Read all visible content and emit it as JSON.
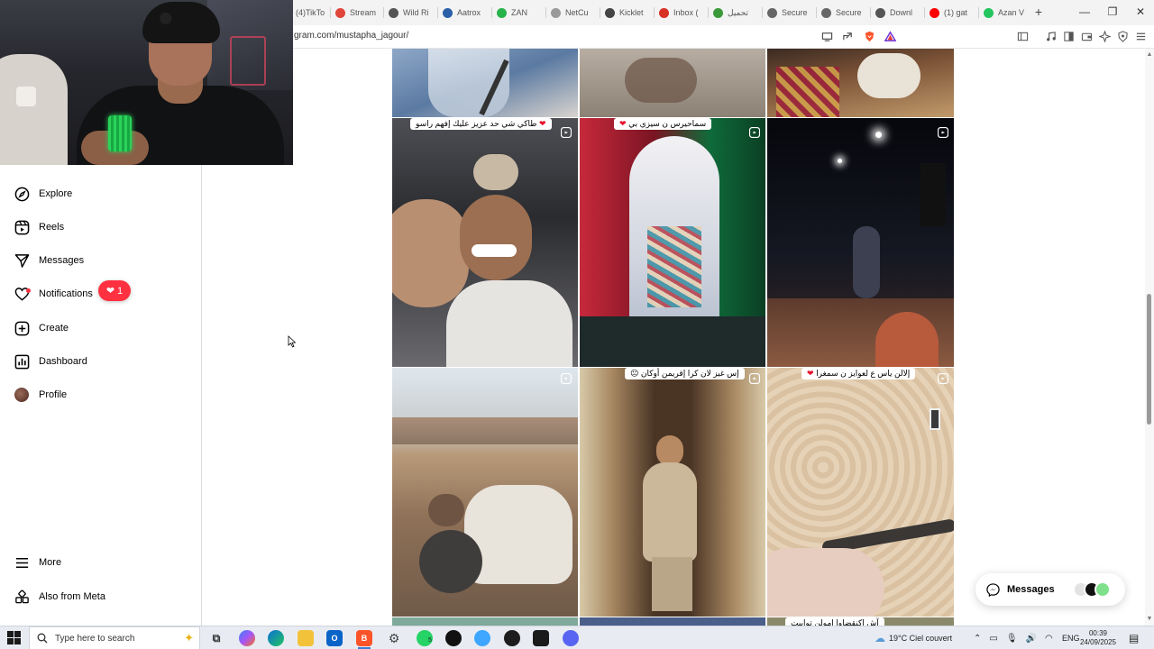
{
  "browser": {
    "tabs": [
      {
        "label": "(4)TikTo",
        "color": "#111111"
      },
      {
        "label": "Stream",
        "color": "#e0463a"
      },
      {
        "label": "Wild Ri",
        "color": "#555555"
      },
      {
        "label": "Aatrox",
        "color": "#2d5fa8"
      },
      {
        "label": "ZAN",
        "color": "#27b34a"
      },
      {
        "label": "NetCu",
        "color": "#9a9a9a"
      },
      {
        "label": "Kicklet",
        "color": "#444444"
      },
      {
        "label": "Inbox (",
        "color": "#d93025"
      },
      {
        "label": "تحميل",
        "color": "#3a9a3a"
      },
      {
        "label": "Secure",
        "color": "#666666"
      },
      {
        "label": "Secure",
        "color": "#666666"
      },
      {
        "label": "Downl",
        "color": "#555555"
      },
      {
        "label": "(1) gat",
        "color": "#ff0000"
      },
      {
        "label": "Azan V",
        "color": "#22c55e"
      }
    ],
    "new_tab": "+",
    "url": "gram.com/mustapha_jagour/",
    "window_controls": {
      "minimize": "—",
      "maximize": "❐",
      "close": "✕"
    }
  },
  "sidebar": {
    "items": [
      {
        "label": "Explore",
        "icon": "compass-icon"
      },
      {
        "label": "Reels",
        "icon": "reels-icon"
      },
      {
        "label": "Messages",
        "icon": "messages-icon"
      },
      {
        "label": "Notifications",
        "icon": "heart-icon"
      },
      {
        "label": "Create",
        "icon": "plus-square-icon"
      },
      {
        "label": "Dashboard",
        "icon": "chart-icon"
      },
      {
        "label": "Profile",
        "icon": "avatar-icon"
      }
    ],
    "notification_count": "1",
    "bottom": [
      {
        "label": "More",
        "icon": "menu-icon"
      },
      {
        "label": "Also from Meta",
        "icon": "meta-icon"
      }
    ]
  },
  "feed": {
    "captions": {
      "r1c1": "طاكي شي حد عزيز عليك إفهم راسو",
      "r1c2": "سماحيرس ن سيزي بي",
      "r2c2": "إس غيز لان كرا إقريمن أوكان",
      "r2c3": "إلالن ياس ع لعوايز ن سمغرا",
      "r3c3": "آش إكنقضاوا امولن توابيت"
    }
  },
  "messages_button": {
    "label": "Messages"
  },
  "taskbar": {
    "search_placeholder": "Type here to search",
    "weather": "19°C  Ciel couvert",
    "language": "ENG",
    "time": "00:39",
    "date": "24/09/2025",
    "whatsapp_badge": "5"
  },
  "colors": {
    "accent_red": "#ff3040",
    "sidebar_border": "#dbdbdb",
    "taskbar_bg": "#e8ecf2"
  }
}
